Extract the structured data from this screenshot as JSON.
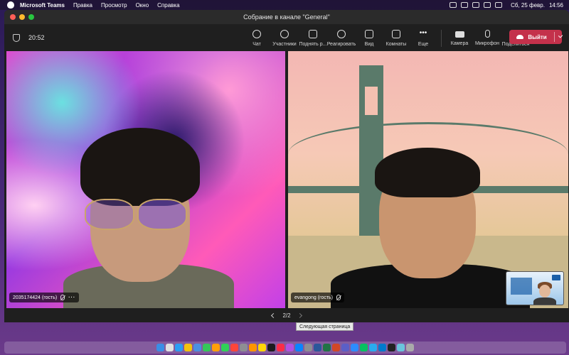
{
  "menubar": {
    "app_name": "Microsoft Teams",
    "items": [
      "Правка",
      "Просмотр",
      "Окно",
      "Справка"
    ],
    "datetime": "Сб, 25 февр.",
    "time": "14:56"
  },
  "window": {
    "title": "Собрание в канале \"General\"",
    "timer": "20:52"
  },
  "toolbar": {
    "chat_label": "Чат",
    "participants_label": "Участники",
    "raise_hand_label": "Поднять р...",
    "react_label": "Реагировать",
    "view_label": "Вид",
    "rooms_label": "Комнаты",
    "more_label": "Еще",
    "camera_label": "Камера",
    "mic_label": "Микрофон",
    "share_label": "Поделиться",
    "leave_label": "Выйти"
  },
  "participants": [
    {
      "name": "2035174424 (гость)",
      "muted": true
    },
    {
      "name": "evangong (гость)",
      "muted": true
    }
  ],
  "pager": {
    "text": "2/2"
  },
  "tooltip": {
    "text": "Следующая страница"
  },
  "colors": {
    "leave_button": "#c4314b",
    "window_bg": "#1f1f1f"
  },
  "dock": {
    "icons": [
      "finder-icon",
      "launchpad-icon",
      "safari-icon",
      "chrome-icon",
      "mail-icon",
      "maps-icon",
      "photos-icon",
      "facetime-icon",
      "calendar-icon",
      "contacts-icon",
      "reminders-icon",
      "notes-icon",
      "tv-icon",
      "music-icon",
      "podcasts-icon",
      "appstore-icon",
      "settings-icon",
      "word-icon",
      "excel-icon",
      "powerpoint-icon",
      "teams-icon",
      "zoom-icon",
      "wechat-icon",
      "telegram-icon",
      "vscode-icon",
      "terminal-icon",
      "preview-icon",
      "trash-icon"
    ]
  }
}
